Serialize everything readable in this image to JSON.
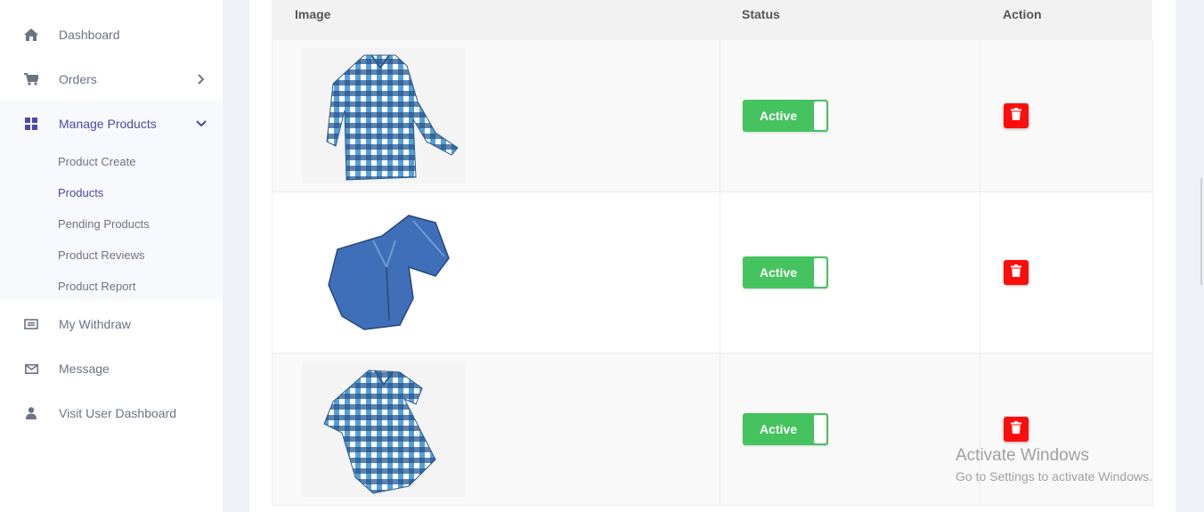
{
  "sidebar": {
    "items": [
      {
        "label": "Dashboard",
        "icon": "home-icon"
      },
      {
        "label": "Orders",
        "icon": "cart-icon"
      },
      {
        "label": "Manage Products",
        "icon": "grid-icon"
      },
      {
        "label": "My Withdraw",
        "icon": "money-icon"
      },
      {
        "label": "Message",
        "icon": "envelope-icon"
      },
      {
        "label": "Visit User Dashboard",
        "icon": "user-icon"
      }
    ],
    "submenu": [
      {
        "label": "Product Create"
      },
      {
        "label": "Products"
      },
      {
        "label": "Pending Products"
      },
      {
        "label": "Product Reviews"
      },
      {
        "label": "Product Report"
      }
    ]
  },
  "table": {
    "headers": {
      "image": "Image",
      "status": "Status",
      "action": "Action"
    },
    "rows": [
      {
        "image": "checkered-blue-shirt-long-sleeve",
        "status": "Active"
      },
      {
        "image": "denim-blue-shirt",
        "status": "Active"
      },
      {
        "image": "checkered-blue-shirt-short-sleeve",
        "status": "Active"
      }
    ]
  },
  "watermark": {
    "title": "Activate Windows",
    "subtitle": "Go to Settings to activate Windows."
  },
  "colors": {
    "accent": "#4b49ac",
    "toggle_green": "#45c35f",
    "delete_red": "#fe0d0d"
  }
}
